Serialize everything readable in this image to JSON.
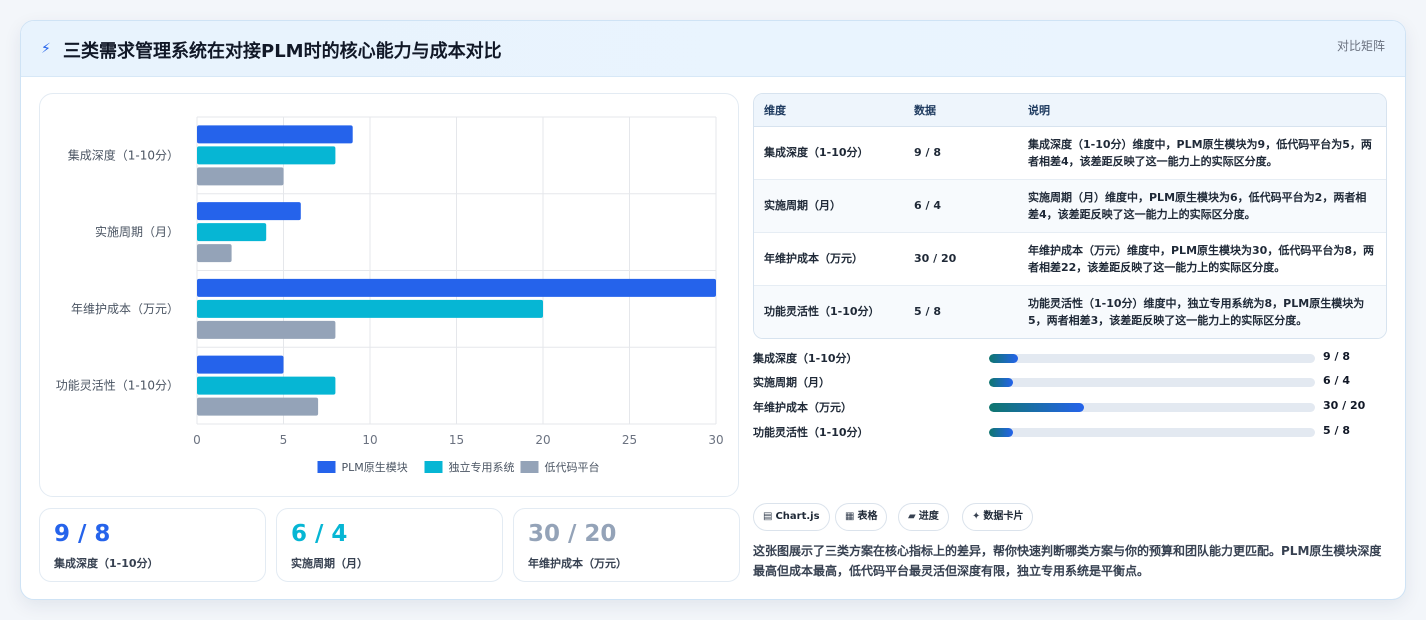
{
  "header": {
    "icon": "bolt-icon",
    "title": "三类需求管理系统在对接PLM时的核心能力与成本对比",
    "tag": "对比矩阵"
  },
  "colors": {
    "plm": "#2563eb",
    "standalone": "#06b6d4",
    "lowcode": "#94a3b8"
  },
  "chart_data": {
    "type": "bar",
    "orientation": "horizontal",
    "categories": [
      "集成深度（1-10分）",
      "实施周期（月）",
      "年维护成本（万元）",
      "功能灵活性（1-10分）"
    ],
    "series": [
      {
        "name": "PLM原生模块",
        "values": [
          9,
          6,
          30,
          5
        ]
      },
      {
        "name": "独立专用系统",
        "values": [
          8,
          4,
          20,
          8
        ]
      },
      {
        "name": "低代码平台",
        "values": [
          5,
          2,
          8,
          7
        ]
      }
    ],
    "xlim": [
      0,
      30
    ],
    "xticks": [
      "0",
      "5",
      "10",
      "15",
      "20",
      "25",
      "30"
    ],
    "grid": true,
    "legend": "bottom"
  },
  "stats": [
    {
      "value": "9 / 8",
      "label": "集成深度（1-10分）",
      "color": "#2563eb"
    },
    {
      "value": "6 / 4",
      "label": "实施周期（月）",
      "color": "#06b6d4"
    },
    {
      "value": "30 / 20",
      "label": "年维护成本（万元）",
      "color": "#94a3b8"
    }
  ],
  "table": {
    "headers": [
      "维度",
      "数据",
      "说明"
    ],
    "rows": [
      {
        "dim": "集成深度（1-10分）",
        "data": "9 / 8",
        "desc": "集成深度（1-10分）维度中，PLM原生模块为9，低代码平台为5，两者相差4，该差距反映了这一能力上的实际区分度。"
      },
      {
        "dim": "实施周期（月）",
        "data": "6 / 4",
        "desc": "实施周期（月）维度中，PLM原生模块为6，低代码平台为2，两者相差4，该差距反映了这一能力上的实际区分度。"
      },
      {
        "dim": "年维护成本（万元）",
        "data": "30 / 20",
        "desc": "年维护成本（万元）维度中，PLM原生模块为30，低代码平台为8，两者相差22，该差距反映了这一能力上的实际区分度。"
      },
      {
        "dim": "功能灵活性（1-10分）",
        "data": "5 / 8",
        "desc": "功能灵活性（1-10分）维度中，独立专用系统为8，PLM原生模块为5，两者相差3，该差距反映了这一能力上的实际区分度。"
      }
    ]
  },
  "progress": [
    {
      "label": "集成深度（1-10分）",
      "value": "9 / 8",
      "fraction": 0.09
    },
    {
      "label": "实施周期（月）",
      "value": "6 / 4",
      "fraction": 0.075
    },
    {
      "label": "年维护成本（万元）",
      "value": "30 / 20",
      "fraction": 0.29
    },
    {
      "label": "功能灵活性（1-10分）",
      "value": "5 / 8",
      "fraction": 0.075
    }
  ],
  "chips": [
    {
      "icon": "chart-icon",
      "glyph": "▤",
      "label": "Chart.js"
    },
    {
      "icon": "table-icon",
      "glyph": "▦",
      "label": "表格"
    },
    {
      "icon": "progress-icon",
      "glyph": "▰",
      "label": "进度"
    },
    {
      "icon": "sparkle-icon",
      "glyph": "✦",
      "label": "数据卡片"
    }
  ],
  "description": "这张图展示了三类方案在核心指标上的差异，帮你快速判断哪类方案与你的预算和团队能力更匹配。PLM原生模块深度最高但成本最高，低代码平台最灵活但深度有限，独立专用系统是平衡点。"
}
